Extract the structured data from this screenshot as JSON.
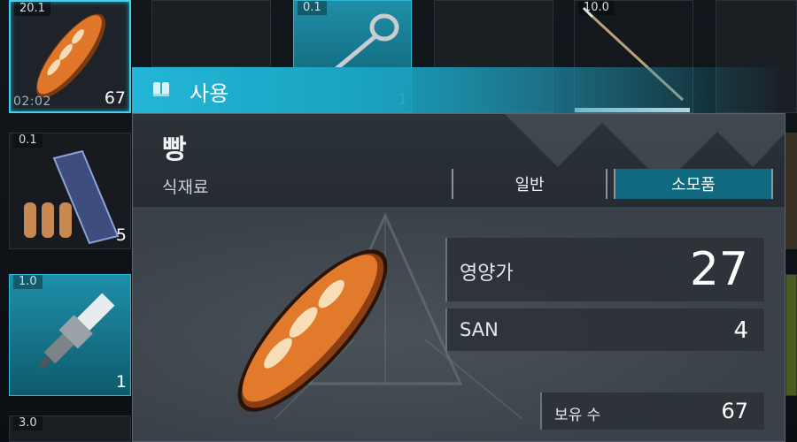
{
  "inventory": {
    "slots": [
      {
        "weight": "20.1",
        "timer": "02:02",
        "qty": "67"
      },
      {
        "weight": "0.1",
        "qty": "1"
      },
      {
        "weight": "10.0"
      },
      {
        "weight": "0.1",
        "qty": "5"
      },
      {
        "weight": "1.0",
        "qty": "1"
      },
      {
        "weight": "3.0"
      }
    ]
  },
  "use_action": {
    "label": "사용",
    "icon": "book-icon"
  },
  "detail": {
    "name": "빵",
    "category": "식재료",
    "tags": {
      "normal": "일반",
      "consumable": "소모품"
    },
    "stats": {
      "nutrition_label": "영양가",
      "nutrition_value": "27",
      "san_label": "SAN",
      "san_value": "4",
      "owned_label": "보유 수",
      "owned_value": "67"
    }
  },
  "colors": {
    "accent": "#23b6d6",
    "tag_active": "#0f6a80",
    "panel": "#3b4249"
  }
}
